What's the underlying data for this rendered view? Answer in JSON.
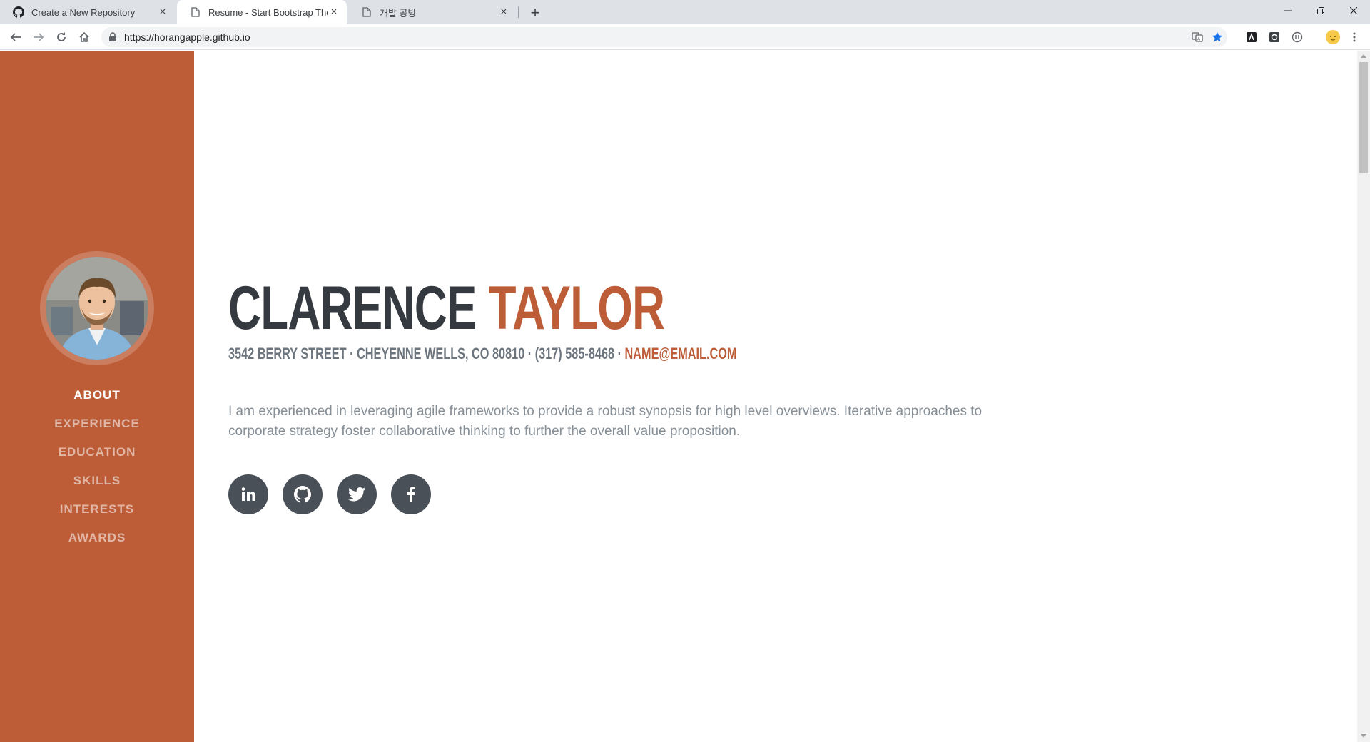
{
  "browser": {
    "tabs": [
      {
        "title": "Create a New Repository",
        "icon": "github-icon"
      },
      {
        "title": "Resume - Start Bootstrap Theme",
        "icon": "page-icon",
        "active": true
      },
      {
        "title": "개발 공방",
        "icon": "page-icon"
      }
    ],
    "url": "https://horangapple.github.io"
  },
  "colors": {
    "primary": "#bd5d38",
    "dark": "#343a40",
    "muted": "#868e96",
    "social": "#495057"
  },
  "sidebar": {
    "nav": [
      {
        "label": "ABOUT",
        "active": true
      },
      {
        "label": "EXPERIENCE"
      },
      {
        "label": "EDUCATION"
      },
      {
        "label": "SKILLS"
      },
      {
        "label": "INTERESTS"
      },
      {
        "label": "AWARDS"
      }
    ]
  },
  "about": {
    "first_name": "CLARENCE",
    "last_name": "TAYLOR",
    "address": "3542 BERRY STREET · CHEYENNE WELLS, CO 80810 · (317) 585-8468 · ",
    "email": "NAME@EMAIL.COM",
    "lead": "I am experienced in leveraging agile frameworks to provide a robust synopsis for high level overviews. Iterative approaches to corporate strategy foster collaborative thinking to further the overall value proposition.",
    "social": [
      {
        "icon": "linkedin-icon"
      },
      {
        "icon": "github-icon"
      },
      {
        "icon": "twitter-icon"
      },
      {
        "icon": "facebook-icon"
      }
    ]
  }
}
